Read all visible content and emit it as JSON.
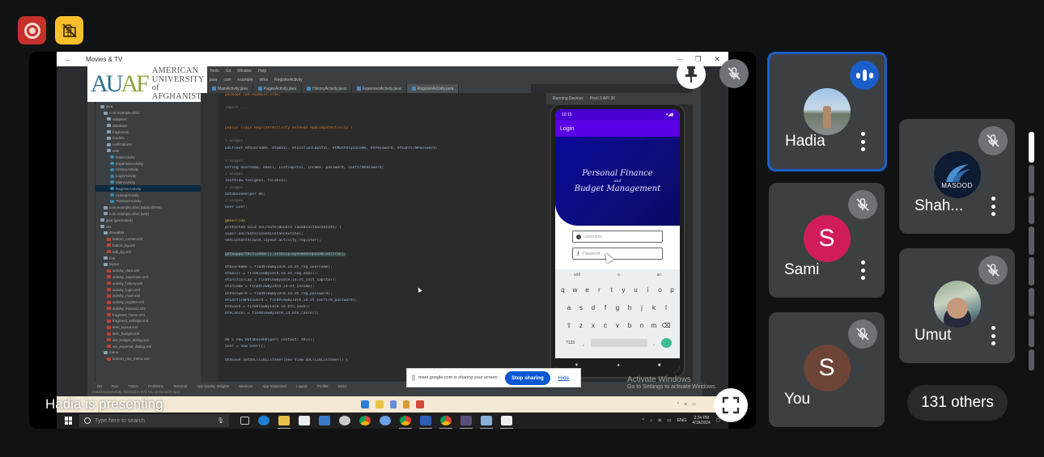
{
  "top_indicators": {
    "recording": {
      "icon": "record-icon",
      "color": "#c5312a"
    },
    "no_upload": {
      "icon": "media-off-icon",
      "color": "#f8bf2b"
    }
  },
  "presentation": {
    "presenter_label": "Hadia is presenting",
    "shared_window": {
      "title": "Movies & TV",
      "logo": {
        "mark_left": "AU",
        "mark_right": "AF",
        "lines": [
          "AMERICAN",
          "UNIVERSITY of",
          "AFGHANISTAN"
        ]
      },
      "ide": {
        "menu": [
          "Tools",
          "Git",
          "Window",
          "Help"
        ],
        "crumbs": [
          "java",
          "com",
          "example",
          "sfms",
          "RegisterActivity"
        ],
        "tabs": [
          "MainActivity.java",
          "PagesActivity.java",
          "HistoryActivity.java",
          "ExpensesActivity.java",
          "RegisterActivity.java"
        ],
        "active_tab_index": 4,
        "project_tree": [
          {
            "label": "java",
            "type": "folder"
          },
          {
            "label": "com.example.sfms",
            "type": "folder"
          },
          {
            "label": "adapters",
            "type": "folder"
          },
          {
            "label": "database",
            "type": "folder"
          },
          {
            "label": "fragments",
            "type": "folder"
          },
          {
            "label": "models",
            "type": "folder"
          },
          {
            "label": "notifications",
            "type": "folder"
          },
          {
            "label": "utils",
            "type": "folder"
          },
          {
            "label": "DataActivity",
            "type": "class"
          },
          {
            "label": "ExpensesActivity",
            "type": "class"
          },
          {
            "label": "HistoryActivity",
            "type": "class"
          },
          {
            "label": "LoginActivity",
            "type": "class"
          },
          {
            "label": "MainActivity",
            "type": "class"
          },
          {
            "label": "RegisterActivity",
            "type": "class",
            "selected": true
          },
          {
            "label": "UploadActivity",
            "type": "class"
          },
          {
            "label": "TransactActivity",
            "type": "class"
          },
          {
            "label": "com.example.sfms (androidTest)",
            "type": "folder"
          },
          {
            "label": "com.example.sfms (test)",
            "type": "folder"
          },
          {
            "label": "java (generated)",
            "type": "folder"
          },
          {
            "label": "res",
            "type": "folder"
          },
          {
            "label": "drawable",
            "type": "folder"
          },
          {
            "label": "bottom_corner.xml",
            "type": "xml"
          },
          {
            "label": "button_bg.xml",
            "type": "xml"
          },
          {
            "label": "edit_bg.xml",
            "type": "xml"
          },
          {
            "label": "font",
            "type": "folder"
          },
          {
            "label": "layout",
            "type": "folder"
          },
          {
            "label": "activity_data.xml",
            "type": "xml"
          },
          {
            "label": "activity_expenses.xml",
            "type": "xml"
          },
          {
            "label": "activity_history.xml",
            "type": "xml"
          },
          {
            "label": "activity_login.xml",
            "type": "xml"
          },
          {
            "label": "activity_main.xml",
            "type": "xml"
          },
          {
            "label": "activity_register.xml",
            "type": "xml"
          },
          {
            "label": "activity_transact.xml",
            "type": "xml"
          },
          {
            "label": "fragment_home.xml",
            "type": "xml"
          },
          {
            "label": "fragment_settings.xml",
            "type": "xml"
          },
          {
            "label": "item_layout.xml",
            "type": "xml"
          },
          {
            "label": "item_budget.xml",
            "type": "xml"
          },
          {
            "label": "set_budget_dialog.xml",
            "type": "xml"
          },
          {
            "label": "set_expense_dialog.xml",
            "type": "xml"
          },
          {
            "label": "menu",
            "type": "folder"
          },
          {
            "label": "bottom_nav_menu.xml",
            "type": "xml"
          }
        ],
        "code_lines": [
          {
            "t": "package com.example.sfms;",
            "k": "kw"
          },
          {
            "t": ""
          },
          {
            "t": "import ...",
            "k": "dim"
          },
          {
            "t": ""
          },
          {
            "t": ""
          },
          {
            "t": "public class RegisterActivity extends AppCompatActivity {",
            "k": "kw"
          },
          {
            "t": ""
          },
          {
            "t": "    5 usages",
            "k": "dim"
          },
          {
            "t": "    EditText etUsername, etEmail, etInitialCapital, etMonthlyIncome, etPassword, etConfirmPassword;"
          },
          {
            "t": ""
          },
          {
            "t": "    9 usages",
            "k": "dim"
          },
          {
            "t": "    String username, email, initCapital, income, password, confirmPassword;"
          },
          {
            "t": "    2 usages",
            "k": "dim"
          },
          {
            "t": "    TextView tvSignIn, tvCancel;"
          },
          {
            "t": "    3 usages",
            "k": "dim"
          },
          {
            "t": "    DatabaseHelper db;"
          },
          {
            "t": "    2 usages",
            "k": "dim"
          },
          {
            "t": "    User user;"
          },
          {
            "t": ""
          },
          {
            "t": "    @Override",
            "k": "an"
          },
          {
            "t": "    protected void onCreate(Bundle savedInstanceState) {"
          },
          {
            "t": "        super.onCreate(savedInstanceState);"
          },
          {
            "t": "        setContentView(R.layout.activity_register);"
          },
          {
            "t": ""
          },
          {
            "t": "        getSupportActionBar().setDisplayHomeAsUpEnabled(true);",
            "k": "hl"
          },
          {
            "t": ""
          },
          {
            "t": "        etUsername = findViewById(R.id.et_reg_username);"
          },
          {
            "t": "        etEmail = findViewById(R.id.et_reg_email);"
          },
          {
            "t": "        etInitialCap = findViewById(R.id.et_init_capital);"
          },
          {
            "t": "        etIncome = findViewById(R.id.et_income);"
          },
          {
            "t": "        etPassword = findViewById(R.id.et_reg_password);"
          },
          {
            "t": "        etConfirmPassword = findViewById(R.id.et_confirm_password);"
          },
          {
            "t": "        btnSave = findViewById(R.id.btn_save);"
          },
          {
            "t": "        btnCancel = findViewById(R.id.btn_cancel);"
          },
          {
            "t": ""
          },
          {
            "t": ""
          },
          {
            "t": ""
          },
          {
            "t": "        db = new DatabaseHelper( context: this);"
          },
          {
            "t": "        user = new User();"
          },
          {
            "t": ""
          },
          {
            "t": "        btnSave.setOnClickListener(new View.OnClickListener() {"
          }
        ],
        "emulator_toolbar": [
          "Running Devices",
          "Pixel 3 API 30"
        ],
        "status_items": [
          "Git",
          "Run",
          "TODO",
          "Problems",
          "Terminal",
          "App Quality Insights",
          "Services",
          "App Inspection",
          "Logcat",
          "Profiler",
          "Build"
        ],
        "status_message": "Install successfully finished in 875 ms. (2 minutes ago)"
      },
      "phone": {
        "status_time": "10:15",
        "app_title": "Login",
        "hero_lines": [
          "Personal Finance",
          "and",
          "Budget Management"
        ],
        "username_placeholder": "Username",
        "password_placeholder": "Password",
        "suggestions": [
          "and",
          "a",
          "an"
        ],
        "rows": [
          [
            "q",
            "w",
            "e",
            "r",
            "t",
            "y",
            "u",
            "i",
            "o",
            "p"
          ],
          [
            "a",
            "s",
            "d",
            "f",
            "g",
            "h",
            "j",
            "k",
            "l"
          ],
          [
            "⇧",
            "z",
            "x",
            "c",
            "v",
            "b",
            "n",
            "m",
            "⌫"
          ]
        ],
        "bottom_left": "?123",
        "bottom_comma": ",",
        "bottom_period": "."
      },
      "share_bar": {
        "message": "meet.google.com is sharing your screen.",
        "stop_label": "Stop sharing",
        "hide_label": "Hide"
      },
      "activate_windows": {
        "title": "Activate Windows",
        "subtitle": "Go to Settings to activate Windows."
      },
      "taskbar": {
        "search_placeholder": "Type here to search",
        "time": "3:24 PM",
        "date": "4/18/2024",
        "language": "ENG"
      }
    }
  },
  "participants": [
    {
      "name": "Hadia",
      "avatar": "photo",
      "state": "speaking",
      "has_menu": true
    },
    {
      "name": "Sami",
      "avatar": "S",
      "avatar_color": "#d01c5b",
      "state": "muted",
      "has_menu": true
    },
    {
      "name": "You",
      "avatar": "S",
      "avatar_color": "#6d4436",
      "state": "muted",
      "has_menu": false
    },
    {
      "name": "Shah...",
      "avatar": "logo",
      "logo_text": "MASOOD",
      "state": "muted",
      "has_menu": true
    },
    {
      "name": "Umut",
      "avatar": "photo",
      "state": "muted",
      "has_menu": true
    }
  ],
  "others_label": "131 others",
  "colors": {
    "background": "#111214",
    "tile": "#3c4043",
    "speaking_border": "#1a5fc9",
    "muted_badge": "#6f7276"
  }
}
